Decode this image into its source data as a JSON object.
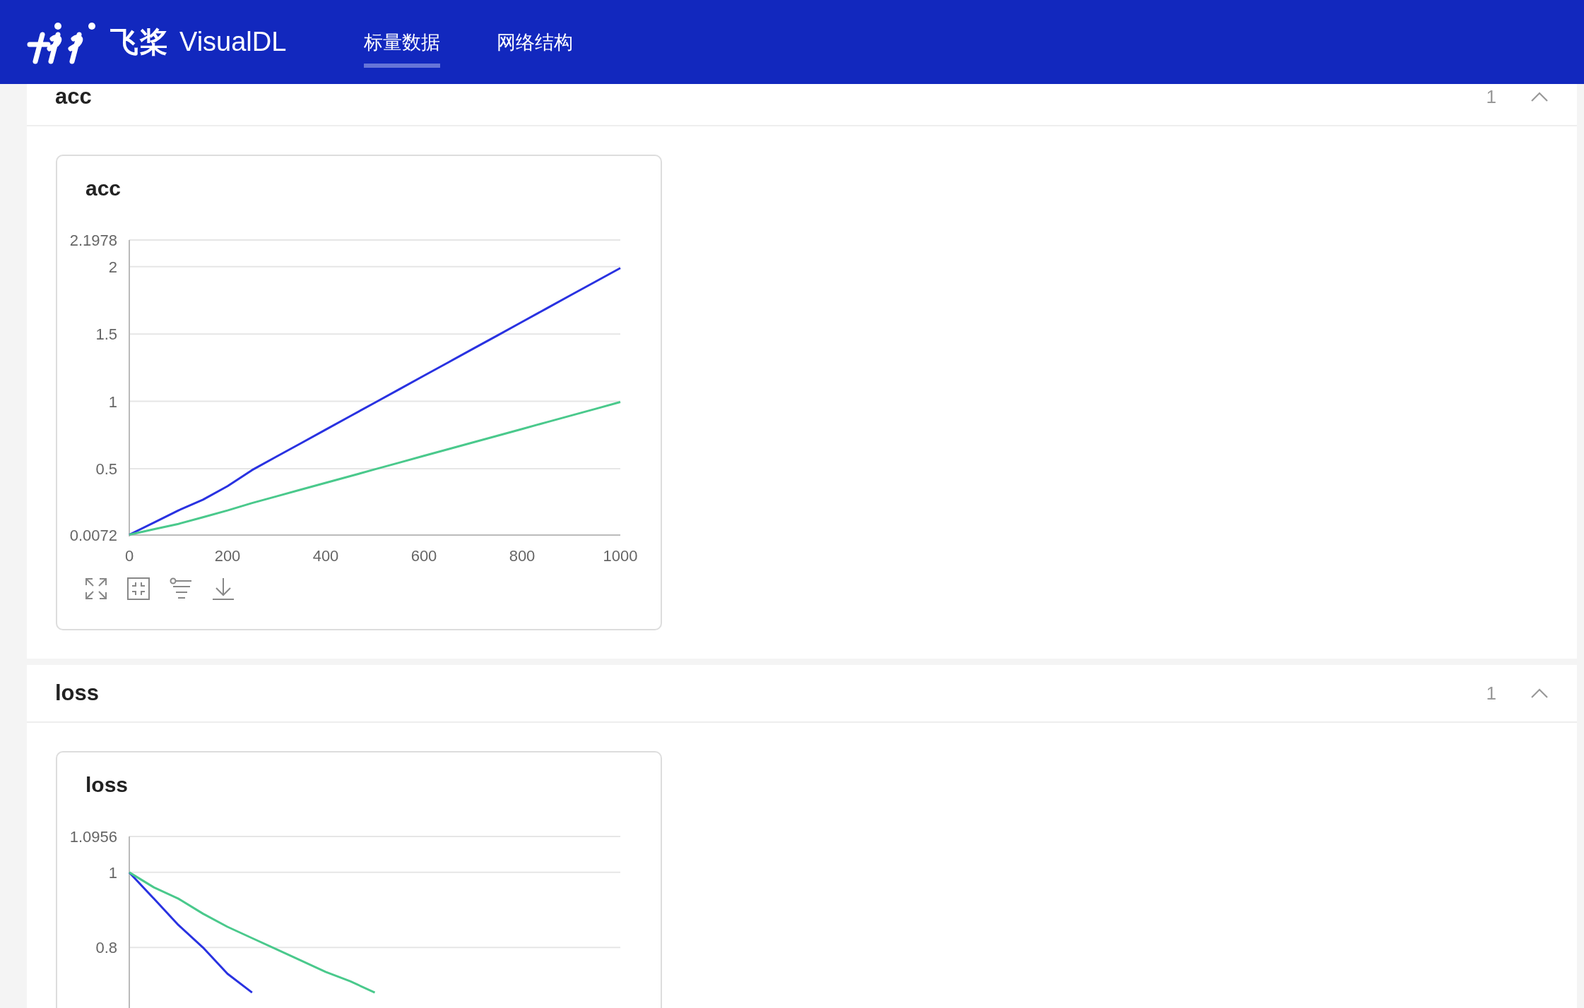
{
  "header": {
    "logo_text": "飞桨",
    "app_name": "VisualDL",
    "tabs": [
      {
        "label": "标量数据",
        "selected": true
      },
      {
        "label": "网络结构",
        "selected": false
      }
    ]
  },
  "sections": [
    {
      "title": "acc",
      "count": "1",
      "expanded": true,
      "charts": [
        {
          "title": "acc",
          "chart_data": {
            "type": "line",
            "grid": true,
            "x": [
              0,
              50,
              100,
              150,
              200,
              250,
              300,
              350,
              400,
              450,
              500,
              550,
              600,
              650,
              700,
              750,
              800,
              850,
              900,
              950,
              1000
            ],
            "series": [
              {
                "color": "#2932e1",
                "values": [
                  0.01,
                  0.1,
                  0.19,
                  0.27,
                  0.37,
                  0.49,
                  0.59,
                  0.69,
                  0.79,
                  0.89,
                  0.99,
                  1.09,
                  1.19,
                  1.29,
                  1.39,
                  1.49,
                  1.59,
                  1.69,
                  1.79,
                  1.89,
                  1.99
                ]
              },
              {
                "color": "#4ac98c",
                "values": [
                  0.01,
                  0.05,
                  0.09,
                  0.14,
                  0.19,
                  0.245,
                  0.295,
                  0.345,
                  0.395,
                  0.445,
                  0.495,
                  0.545,
                  0.595,
                  0.645,
                  0.695,
                  0.745,
                  0.795,
                  0.845,
                  0.895,
                  0.945,
                  0.995
                ]
              }
            ],
            "xlim": [
              0,
              1000
            ],
            "ylim": [
              0.0072,
              2.1978
            ],
            "xticks": [
              0,
              200,
              400,
              600,
              800,
              1000
            ],
            "yticks": [
              0.0072,
              0.5,
              1,
              1.5,
              2,
              2.1978
            ]
          }
        }
      ]
    },
    {
      "title": "loss",
      "count": "1",
      "expanded": true,
      "charts": [
        {
          "title": "loss",
          "chart_data": {
            "type": "line",
            "grid": true,
            "x": [
              0,
              50,
              100,
              150,
              200,
              250,
              300,
              350,
              400,
              450,
              500
            ],
            "series": [
              {
                "color": "#2932e1",
                "values": [
                  1,
                  0.93,
                  0.86,
                  0.8,
                  0.73,
                  0.68,
                  null,
                  null,
                  null,
                  null,
                  null
                ]
              },
              {
                "color": "#4ac98c",
                "values": [
                  1,
                  0.96,
                  0.93,
                  0.89,
                  0.855,
                  0.825,
                  0.795,
                  0.765,
                  0.735,
                  0.71,
                  0.68
                ]
              }
            ],
            "xlim": [
              0,
              1000
            ],
            "ylim": [
              0.31,
              1.0956
            ],
            "yticks": [
              0.8,
              1,
              1.0956
            ]
          }
        }
      ]
    }
  ]
}
